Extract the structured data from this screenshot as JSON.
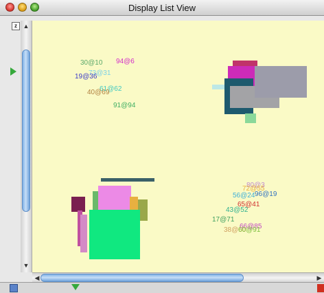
{
  "window": {
    "title": "Display List View"
  },
  "controls": {
    "z_button": "z"
  },
  "colors": {
    "canvas_bg": "#fafac6",
    "scroll_thumb": "#7fb1e6"
  },
  "icons": {
    "close": "close-icon",
    "minimize": "minimize-icon",
    "zoom": "zoom-icon",
    "scroll_up": "chevron-up-icon",
    "scroll_down": "chevron-down-icon",
    "scroll_left": "chevron-left-icon",
    "scroll_right": "chevron-right-icon"
  },
  "scrollbars": {
    "vertical": {
      "position_fraction": 0.15
    },
    "horizontal": {
      "position_fraction": 0.0
    }
  },
  "display_list": {
    "labels": [
      {
        "text": "30@10",
        "color": "#5aa86b"
      },
      {
        "text": "94@6",
        "color": "#d22bc9"
      },
      {
        "text": "73@31",
        "color": "#7ad0e8"
      },
      {
        "text": "19@36",
        "color": "#3c3cc8"
      },
      {
        "text": "61@62",
        "color": "#40c8c0"
      },
      {
        "text": "40@69",
        "color": "#b08040"
      },
      {
        "text": "91@94",
        "color": "#3fae63"
      },
      {
        "text": "80@3",
        "color": "#c08ad0"
      },
      {
        "text": "72@55",
        "color": "#e8b040"
      },
      {
        "text": "56@24",
        "color": "#40b0d8"
      },
      {
        "text": "96@19",
        "color": "#3070c0"
      },
      {
        "text": "65@41",
        "color": "#d03030"
      },
      {
        "text": "43@52",
        "color": "#30b090"
      },
      {
        "text": "17@71",
        "color": "#40a060"
      },
      {
        "text": "66@85",
        "color": "#c04ac0"
      },
      {
        "text": "38@60",
        "color": "#d0a060"
      },
      {
        "text": "60@91",
        "color": "#80c040"
      }
    ],
    "shapes": [
      {
        "color": "#c0336a"
      },
      {
        "color": "#cc2bb8"
      },
      {
        "color": "#1e5a6e"
      },
      {
        "color": "#a3a3a6"
      },
      {
        "color": "#9c9caa"
      },
      {
        "color": "#bde8e6"
      },
      {
        "color": "#8ad89a"
      },
      {
        "color": "#3a6068"
      },
      {
        "color": "#6ab96a"
      },
      {
        "color": "#ec8ae6"
      },
      {
        "color": "#e8b040"
      },
      {
        "color": "#9aa84a"
      },
      {
        "color": "#7a2050"
      },
      {
        "color": "#c050a0"
      },
      {
        "color": "#d48ac6"
      },
      {
        "color": "#10e880"
      }
    ]
  }
}
